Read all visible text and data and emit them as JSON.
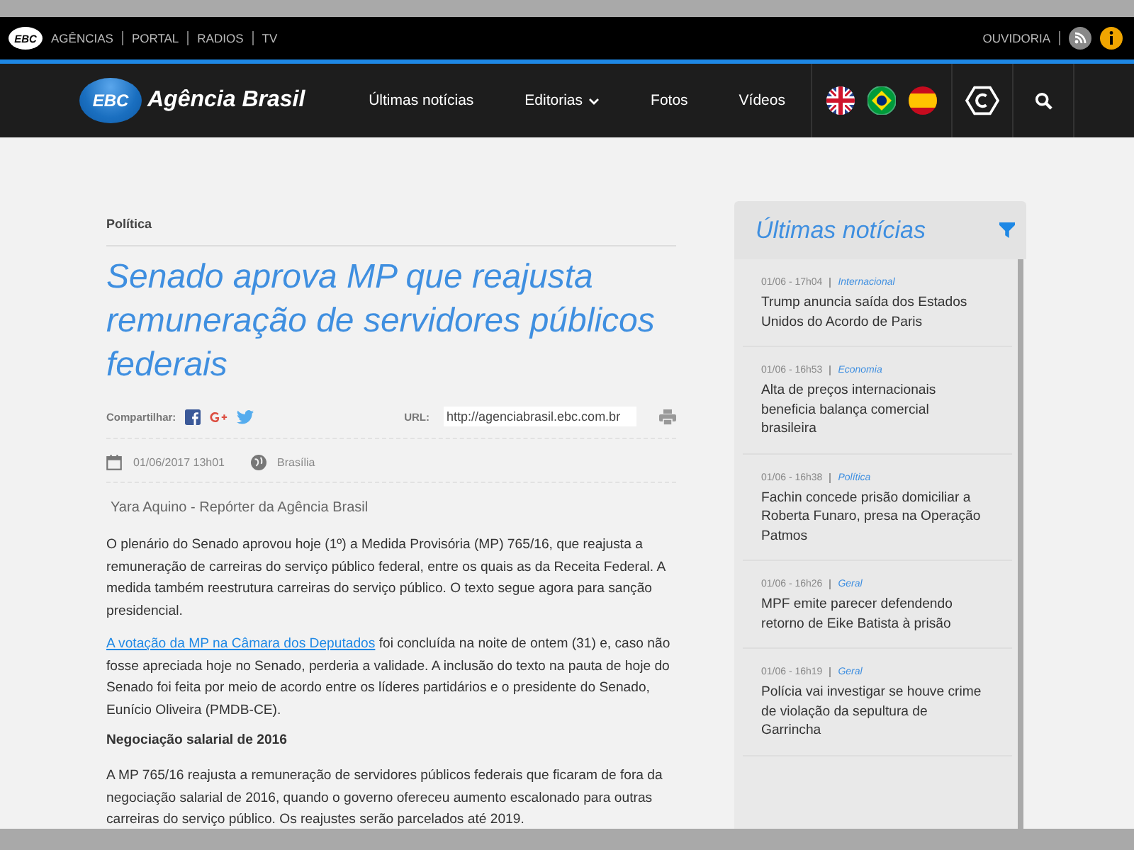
{
  "top_bar": {
    "logo": "EBC",
    "links": [
      "AGÊNCIAS",
      "PORTAL",
      "RADIOS",
      "TV"
    ],
    "right_link": "OUVIDORIA"
  },
  "nav": {
    "logo": "EBC",
    "site_name": "Agência Brasil",
    "items": [
      {
        "label": "Últimas notícias",
        "dropdown": false
      },
      {
        "label": "Editorias",
        "dropdown": true
      },
      {
        "label": "Fotos",
        "dropdown": false
      },
      {
        "label": "Vídeos",
        "dropdown": false
      }
    ]
  },
  "article": {
    "section": "Política",
    "headline": "Senado aprova MP que reajusta remuneração de servidores públicos federais",
    "share_label": "Compartilhar:",
    "url_label": "URL:",
    "url_value": "http://agenciabrasil.ebc.com.br",
    "date": "01/06/2017 13h01",
    "place": "Brasília",
    "byline": "Yara Aquino - Repórter da Agência Brasil",
    "blocks": [
      {
        "kind": "paragraph",
        "text": "O plenário do Senado aprovou hoje (1º) a Medida Provisória (MP) 765/16, que reajusta a remuneração de carreiras do serviço público federal, entre os quais as da Receita Federal. A medida também reestrutura carreiras do serviço público. O texto segue agora para sanção presidencial."
      },
      {
        "kind": "paragraph",
        "link": "A votação da MP na Câmara dos Deputados",
        "text": " foi concluída na noite de ontem (31) e, caso não fosse apreciada hoje no Senado, perderia a validade. A inclusão do texto na pauta de hoje do Senado foi feita por meio de acordo entre os líderes partidários e o presidente do Senado, Eunício Oliveira (PMDB-CE)."
      },
      {
        "kind": "heading",
        "text": "Negociação salarial de 2016"
      },
      {
        "kind": "paragraph",
        "text": "A MP 765/16 reajusta a remuneração de servidores públicos federais que ficaram de fora da negociação salarial de 2016, quando o governo ofereceu aumento escalonado para outras carreiras do serviço público. Os reajustes serão parcelados até 2019."
      }
    ]
  },
  "sidebar": {
    "title": "Últimas notícias",
    "items": [
      {
        "time": "01/06 - 17h04",
        "category": "Internacional",
        "title": "Trump anuncia saída dos Estados Unidos do Acordo de Paris"
      },
      {
        "time": "01/06 - 16h53",
        "category": "Economia",
        "title": "Alta de preços internacionais beneficia balança comercial brasileira"
      },
      {
        "time": "01/06 - 16h38",
        "category": "Política",
        "title": "Fachin concede prisão domiciliar a Roberta Funaro, presa na Operação Patmos"
      },
      {
        "time": "01/06 - 16h26",
        "category": "Geral",
        "title": "MPF emite parecer defendendo retorno de Eike Batista à prisão"
      },
      {
        "time": "01/06 - 16h19",
        "category": "Geral",
        "title": "Polícia vai investigar se houve crime de violação da sepultura de Garrincha"
      }
    ]
  }
}
